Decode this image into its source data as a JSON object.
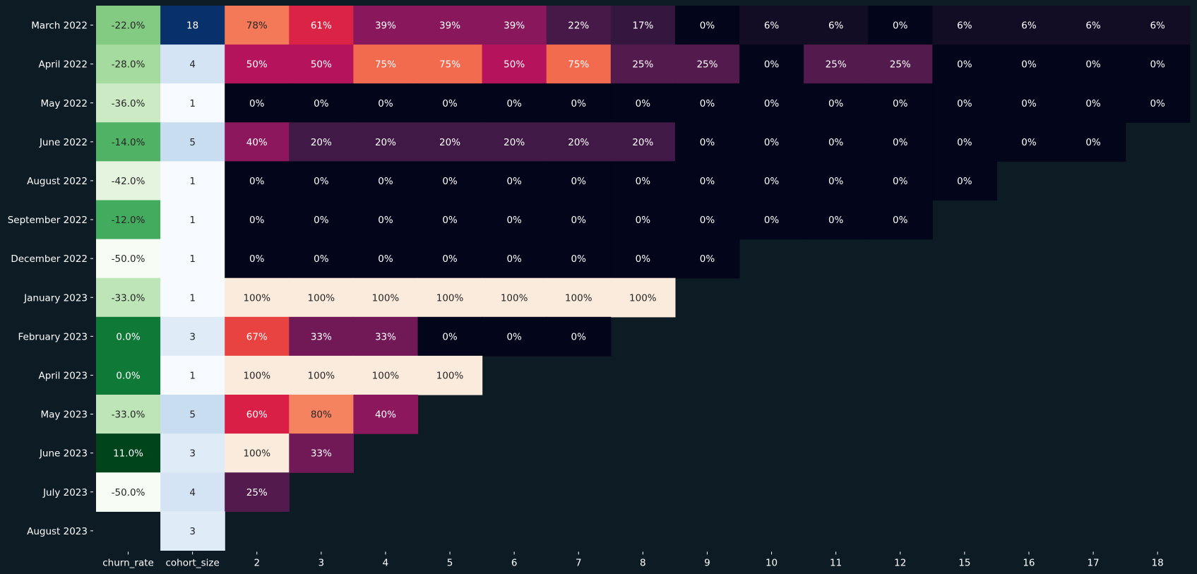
{
  "chart_data": {
    "type": "heatmap",
    "title": "",
    "xlabel": "",
    "ylabel": "",
    "background": "#0d1b25",
    "columns": [
      "churn_rate",
      "cohort_size",
      "2",
      "3",
      "4",
      "5",
      "6",
      "7",
      "8",
      "9",
      "10",
      "11",
      "12",
      "15",
      "16",
      "17",
      "18"
    ],
    "rows": [
      {
        "label": "March 2022",
        "churn_rate": "-22.0%",
        "churn_value": -22.0,
        "cohort_size": 18,
        "retention": [
          78,
          61,
          39,
          39,
          39,
          22,
          17,
          0,
          6,
          6,
          0,
          6,
          6,
          6,
          6
        ]
      },
      {
        "label": "April 2022",
        "churn_rate": "-28.0%",
        "churn_value": -28.0,
        "cohort_size": 4,
        "retention": [
          50,
          50,
          75,
          75,
          50,
          75,
          25,
          25,
          0,
          25,
          25,
          0,
          0,
          0,
          0
        ]
      },
      {
        "label": "May 2022",
        "churn_rate": "-36.0%",
        "churn_value": -36.0,
        "cohort_size": 1,
        "retention": [
          0,
          0,
          0,
          0,
          0,
          0,
          0,
          0,
          0,
          0,
          0,
          0,
          0,
          0,
          0
        ]
      },
      {
        "label": "June 2022",
        "churn_rate": "-14.0%",
        "churn_value": -14.0,
        "cohort_size": 5,
        "retention": [
          40,
          20,
          20,
          20,
          20,
          20,
          20,
          0,
          0,
          0,
          0,
          0,
          0,
          0
        ]
      },
      {
        "label": "August 2022",
        "churn_rate": "-42.0%",
        "churn_value": -42.0,
        "cohort_size": 1,
        "retention": [
          0,
          0,
          0,
          0,
          0,
          0,
          0,
          0,
          0,
          0,
          0,
          0
        ]
      },
      {
        "label": "September 2022",
        "churn_rate": "-12.0%",
        "churn_value": -12.0,
        "cohort_size": 1,
        "retention": [
          0,
          0,
          0,
          0,
          0,
          0,
          0,
          0,
          0,
          0,
          0
        ]
      },
      {
        "label": "December 2022",
        "churn_rate": "-50.0%",
        "churn_value": -50.0,
        "cohort_size": 1,
        "retention": [
          0,
          0,
          0,
          0,
          0,
          0,
          0,
          0
        ]
      },
      {
        "label": "January 2023",
        "churn_rate": "-33.0%",
        "churn_value": -33.0,
        "cohort_size": 1,
        "retention": [
          100,
          100,
          100,
          100,
          100,
          100,
          100
        ]
      },
      {
        "label": "February 2023",
        "churn_rate": "0.0%",
        "churn_value": 0.0,
        "cohort_size": 3,
        "retention": [
          67,
          33,
          33,
          0,
          0,
          0
        ]
      },
      {
        "label": "April 2023",
        "churn_rate": "0.0%",
        "churn_value": 0.0,
        "cohort_size": 1,
        "retention": [
          100,
          100,
          100,
          100
        ]
      },
      {
        "label": "May 2023",
        "churn_rate": "-33.0%",
        "churn_value": -33.0,
        "cohort_size": 5,
        "retention": [
          60,
          80,
          40
        ]
      },
      {
        "label": "June 2023",
        "churn_rate": "11.0%",
        "churn_value": 11.0,
        "cohort_size": 3,
        "retention": [
          100,
          33
        ]
      },
      {
        "label": "July 2023",
        "churn_rate": "-50.0%",
        "churn_value": -50.0,
        "cohort_size": 4,
        "retention": [
          25
        ]
      },
      {
        "label": "August 2023",
        "churn_rate": "",
        "churn_value": null,
        "cohort_size": 3,
        "retention": []
      }
    ],
    "colormaps": {
      "churn_rate": "Greens",
      "cohort_size": "Blues",
      "retention": "rocket"
    }
  }
}
